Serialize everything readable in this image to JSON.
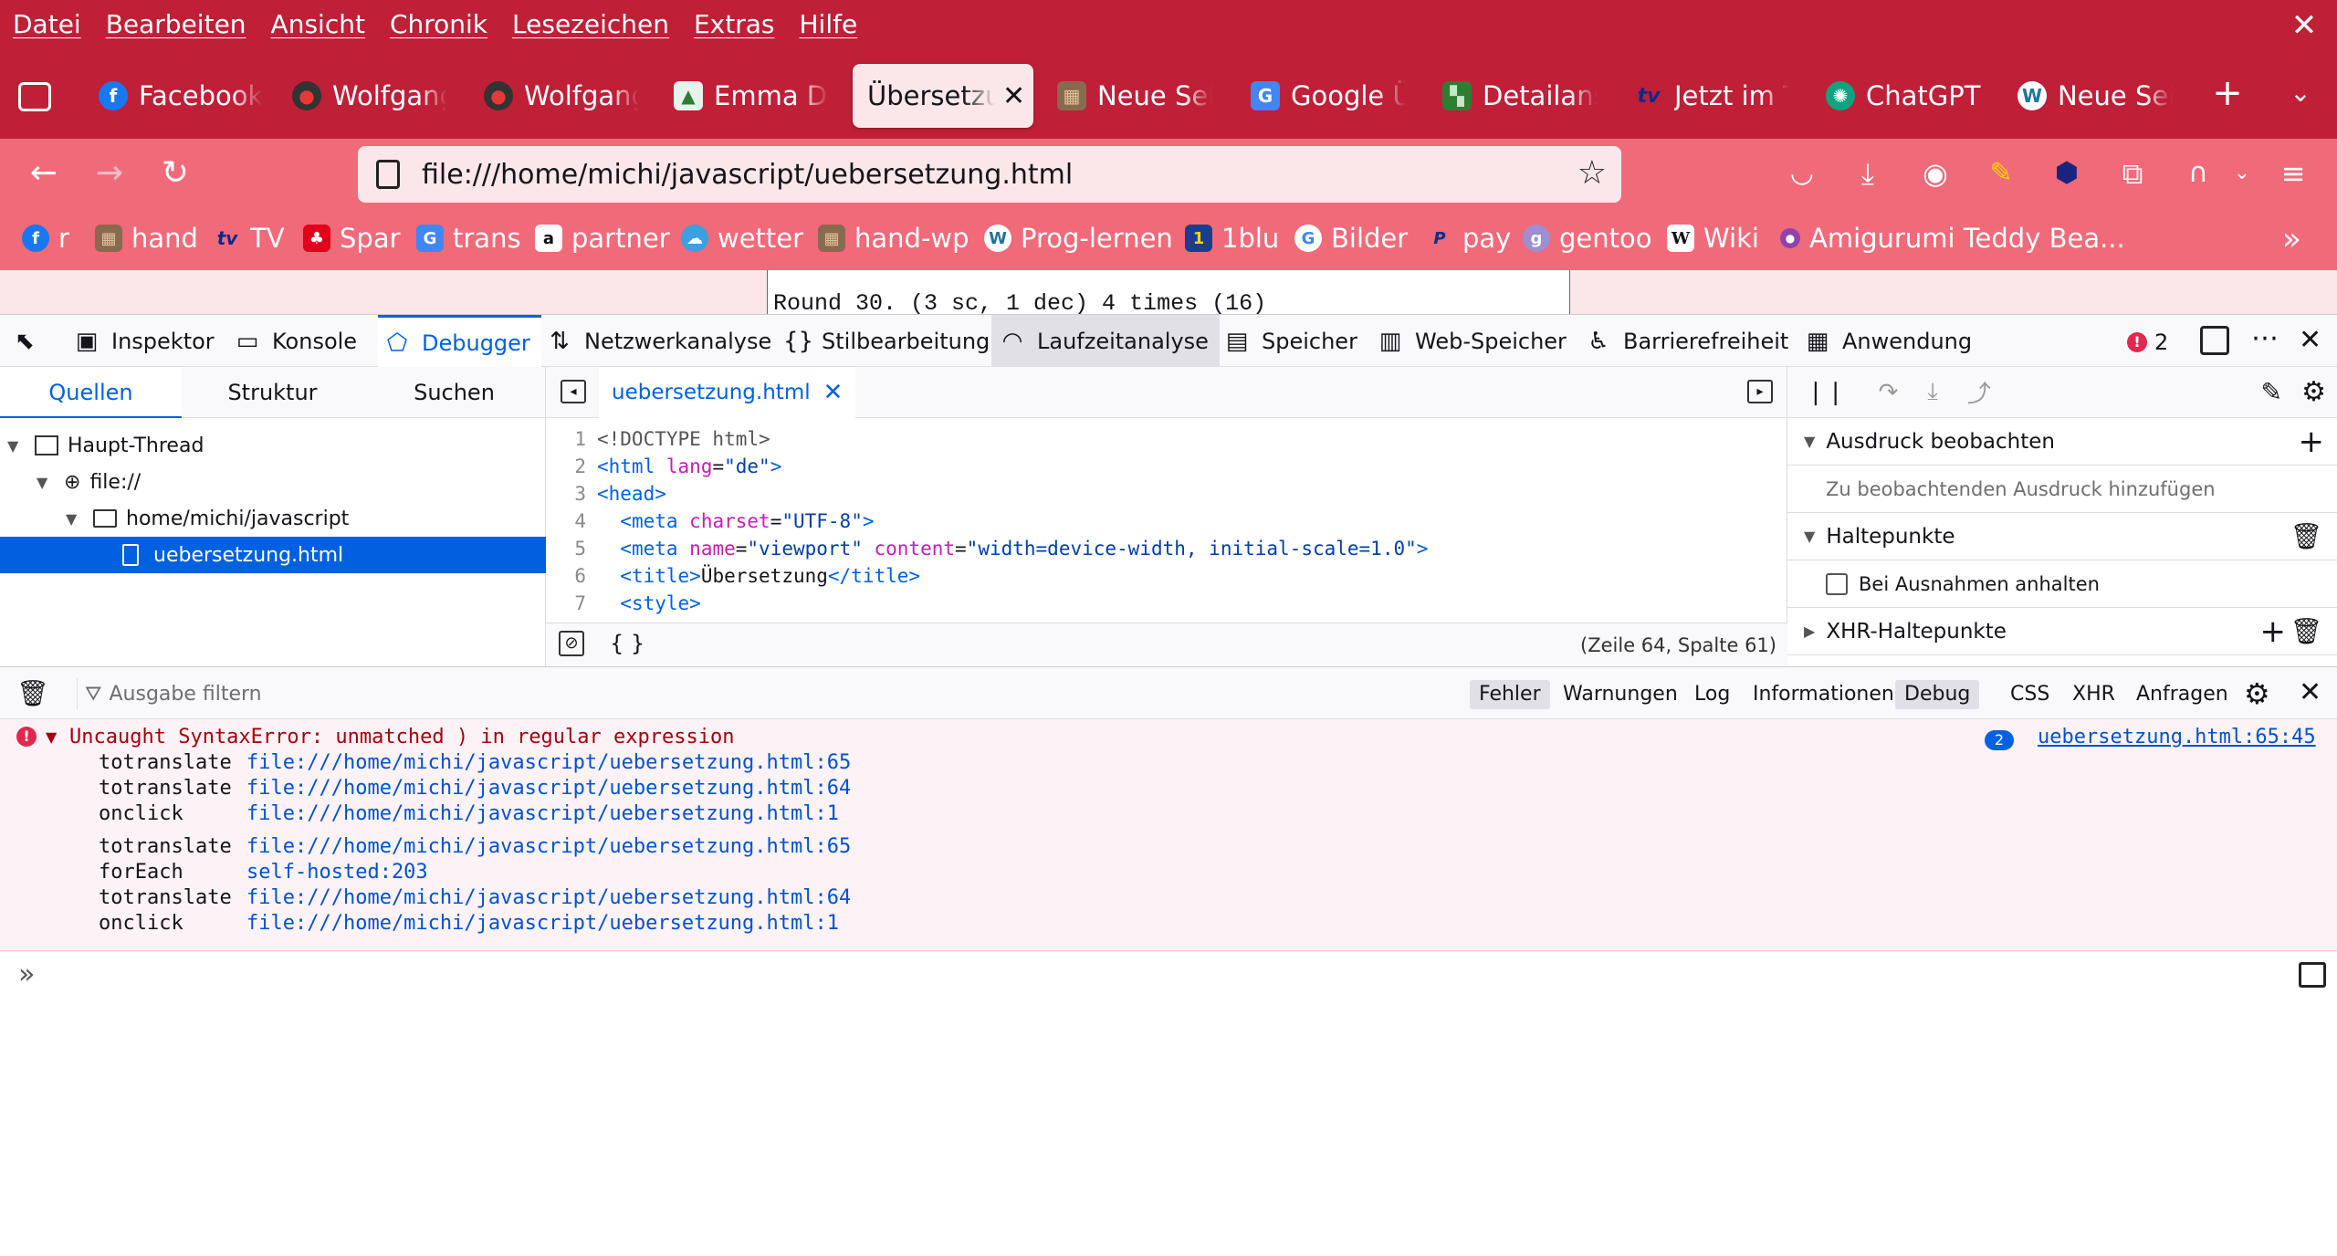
{
  "menu": [
    "Datei",
    "Bearbeiten",
    "Ansicht",
    "Chronik",
    "Lesezeichen",
    "Extras",
    "Hilfe"
  ],
  "tabs": [
    {
      "label": "Facebook",
      "icon": "facebook-icon",
      "color": "#1877f2",
      "glyph": "f"
    },
    {
      "label": "Wolfgang",
      "icon": "avatar-icon",
      "color": "#333333",
      "glyph": "●"
    },
    {
      "label": "Wolfgang",
      "icon": "avatar-icon",
      "color": "#333333",
      "glyph": "●"
    },
    {
      "label": "Emma Do",
      "icon": "doc-icon",
      "color": "#e8f2ec",
      "glyph": "▲"
    },
    {
      "label": "Übersetzung",
      "icon": "page-icon",
      "active": true
    },
    {
      "label": "Neue Seite",
      "icon": "photo-icon",
      "color": "#8a6a4f",
      "glyph": "▦"
    },
    {
      "label": "Google Übersetzer",
      "icon": "google-translate-icon",
      "color": "#4285f4",
      "glyph": "G"
    },
    {
      "label": "Detailansicht",
      "icon": "grid-icon",
      "color": "#2e7d32",
      "glyph": "▚"
    },
    {
      "label": "Jetzt im TV",
      "icon": "tv-icon",
      "color": "#0d2a8a",
      "glyph": "tv"
    },
    {
      "label": "ChatGPT",
      "icon": "chatgpt-icon",
      "color": "#10a37f",
      "glyph": "✺"
    },
    {
      "label": "Neue Seite",
      "icon": "wordpress-icon",
      "color": "#21759b",
      "glyph": "W"
    }
  ],
  "url": "file:///home/michi/javascript/uebersetzung.html",
  "bookmarks": [
    {
      "label": "r",
      "icon": "facebook-icon",
      "color": "#1877f2",
      "glyph": "f"
    },
    {
      "label": "hand",
      "icon": "photo-icon",
      "color": "#8a6a4f",
      "glyph": "▦"
    },
    {
      "label": "TV",
      "icon": "tv-icon",
      "color": "#0d2a8a",
      "glyph": "tv"
    },
    {
      "label": "Spar",
      "icon": "spar-icon",
      "color": "#e2001a",
      "glyph": "♣"
    },
    {
      "label": "trans",
      "icon": "google-translate-icon",
      "color": "#4285f4",
      "glyph": "G"
    },
    {
      "label": "partner",
      "icon": "amazon-icon",
      "color": "#ffffff",
      "glyph": "a"
    },
    {
      "label": "wetter",
      "icon": "weather-icon",
      "color": "#3aa0e0",
      "glyph": "☁"
    },
    {
      "label": "hand-wp",
      "icon": "photo-icon",
      "color": "#8a6a4f",
      "glyph": "▦"
    },
    {
      "label": "Prog-lernen",
      "icon": "wordpress-icon",
      "color": "#21759b",
      "glyph": "W"
    },
    {
      "label": "1blu",
      "icon": "1blu-icon",
      "color": "#1a3d8f",
      "glyph": "1"
    },
    {
      "label": "Bilder",
      "icon": "google-icon",
      "color": "#ffffff",
      "glyph": "G"
    },
    {
      "label": "pay",
      "icon": "paypal-icon",
      "color": "#003087",
      "glyph": "P"
    },
    {
      "label": "gentoo",
      "icon": "gentoo-icon",
      "color": "#9d8fd1",
      "glyph": "g"
    },
    {
      "label": "Wiki",
      "icon": "wikipedia-icon",
      "color": "#ffffff",
      "glyph": "W"
    },
    {
      "label": "Amigurumi Teddy Bea...",
      "icon": "yarn-icon",
      "color": "#8e44ad",
      "glyph": "●"
    }
  ],
  "page_text": "Round 30. (3 sc, 1 dec) 4 times (16)",
  "devtools": {
    "tabs": [
      "Inspektor",
      "Konsole",
      "Debugger",
      "Netzwerkanalyse",
      "Stilbearbeitung",
      "Laufzeitanalyse",
      "Speicher",
      "Web-Speicher",
      "Barrierefreiheit",
      "Anwendung"
    ],
    "error_count": "2"
  },
  "sources": {
    "tabs": [
      "Quellen",
      "Struktur",
      "Suchen"
    ],
    "tree": [
      "Haupt-Thread",
      "file://",
      "home/michi/javascript",
      "uebersetzung.html"
    ]
  },
  "editor": {
    "file": "uebersetzung.html",
    "position": "(Zeile 64, Spalte 61)",
    "format_label": "{ }"
  },
  "right_panel": {
    "watch_title": "Ausdruck beobachten",
    "watch_placeholder": "Zu beobachtenden Ausdruck hinzufügen",
    "breakpoints_title": "Haltepunkte",
    "pause_exceptions": "Bei Ausnahmen anhalten",
    "xhr_title": "XHR-Haltepunkte"
  },
  "console": {
    "filter_placeholder": "Ausgabe filtern",
    "filters": [
      "Fehler",
      "Warnungen",
      "Log",
      "Informationen",
      "Debug",
      "CSS",
      "XHR",
      "Anfragen"
    ],
    "error_message": "Uncaught SyntaxError: unmatched ) in regular expression",
    "error_count": "2",
    "error_location": "uebersetzung.html:65:45",
    "stack1": [
      {
        "fn": "totranslate",
        "loc": "file:///home/michi/javascript/uebersetzung.html:65"
      },
      {
        "fn": "totranslate",
        "loc": "file:///home/michi/javascript/uebersetzung.html:64"
      },
      {
        "fn": "onclick",
        "loc": "file:///home/michi/javascript/uebersetzung.html:1"
      }
    ],
    "stack2": [
      {
        "fn": "totranslate",
        "loc": "file:///home/michi/javascript/uebersetzung.html:65"
      },
      {
        "fn": "forEach",
        "loc": "self-hosted:203"
      },
      {
        "fn": "totranslate",
        "loc": "file:///home/michi/javascript/uebersetzung.html:64"
      },
      {
        "fn": "onclick",
        "loc": "file:///home/michi/javascript/uebersetzung.html:1"
      }
    ]
  }
}
